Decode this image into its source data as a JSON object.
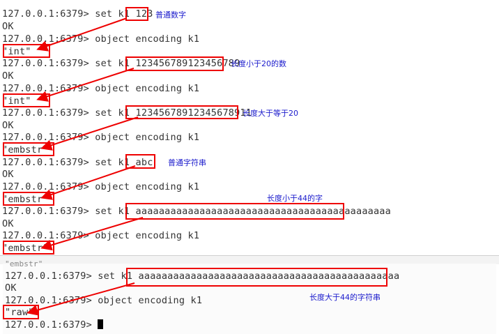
{
  "terminal_top": {
    "lines": [
      "127.0.0.1:6379> set k1 123",
      "OK",
      "127.0.0.1:6379> object encoding k1",
      "\"int\"",
      "127.0.0.1:6379> set k1 123456789123456789",
      "OK",
      "127.0.0.1:6379> object encoding k1",
      "\"int\"",
      "127.0.0.1:6379> set k1 12345678912345678911",
      "OK",
      "127.0.0.1:6379> object encoding k1",
      "\"embstr\"",
      "127.0.0.1:6379> set k1 abc",
      "OK",
      "127.0.0.1:6379> object encoding k1",
      "\"embstr\"",
      "127.0.0.1:6379> set k1 aaaaaaaaaaaaaaaaaaaaaaaaaaaaaaaaaaaaaaaaaaaa",
      "OK",
      "127.0.0.1:6379> object encoding k1",
      "\"embstr\""
    ]
  },
  "terminal_bottom": {
    "lines": [
      "\"embstr\"",
      "127.0.0.1:6379> set k1 aaaaaaaaaaaaaaaaaaaaaaaaaaaaaaaaaaaaaaaaaaaaa",
      "OK",
      "127.0.0.1:6379> object encoding k1",
      "\"raw\"",
      "127.0.0.1:6379> "
    ]
  },
  "annotations": {
    "plain_number": "普通数字",
    "len_lt_20": "长度小于20的数",
    "len_ge_20": "长度大于等于20",
    "plain_string": "普通字符串",
    "len_lt_44": "长度小于44的字",
    "len_gt_44": "长度大于44的字符串"
  },
  "colors": {
    "highlight": "#ee0000",
    "annotation_text": "#1a1acc",
    "terminal_text": "#333333"
  }
}
